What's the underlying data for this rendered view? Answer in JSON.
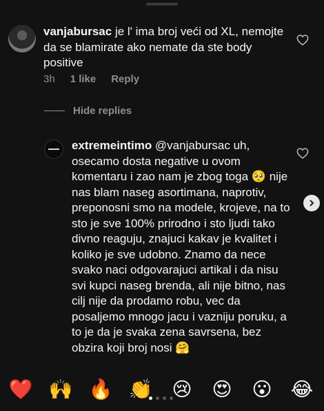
{
  "comment_main": {
    "username": "vanjabursac",
    "text": " je l' ima broj veći od XL, nemojte da se blamirate ako nemate da ste body positive",
    "time": "3h",
    "likes": "1 like",
    "reply_label": "Reply"
  },
  "replies_toggle": "Hide replies",
  "reply": {
    "username": "extremeintimo",
    "text_part1": " @vanjabursac uh, osecamo dosta negative u ovom komentaru i zao nam je zbog toga ",
    "emoji1": "🥺",
    "text_part2": " nije nas blam naseg asortimana, naprotiv, preponosni smo na modele, krojeve, na to sto je sve 100% prirodno i sto ljudi tako divno reaguju, znajuci kakav je kvalitet i koliko je sve udobno. Znamo da nece svako naci odgovarajuci artikal i da nisu svi kupci naseg brenda, ali nije bitno, nas cilj nije da prodamo robu, vec da posaljemo mnogo jacu i vazniju poruku, a to je da je svaka zena savrsena, bez obzira koji broj nosi ",
    "emoji2": "🤗"
  },
  "reactions": [
    "❤️",
    "🙌",
    "🔥",
    "👏",
    "😢",
    "😍",
    "😮",
    "😂"
  ],
  "icons": {
    "like": "heart-outline-icon",
    "scroll": "chevron-right-icon"
  },
  "colors": {
    "background": "#121212",
    "secondary_text": "#8e8e8e"
  }
}
